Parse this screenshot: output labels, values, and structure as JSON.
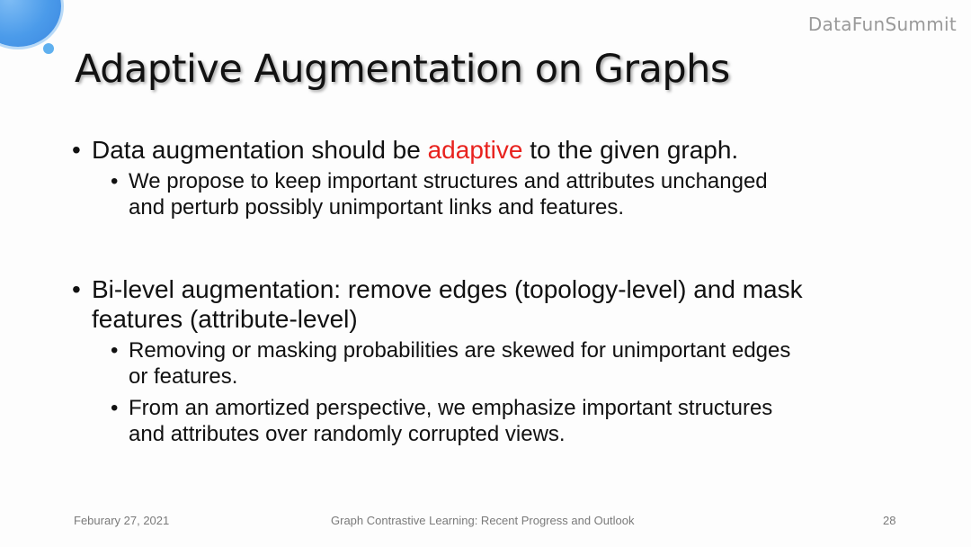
{
  "brand": "DataFunSummit",
  "title": "Adaptive Augmentation on Graphs",
  "bullets": [
    {
      "text_before": "Data augmentation should be ",
      "highlight": "adaptive",
      "text_after": " to the given graph.",
      "sub": [
        {
          "line1": "We propose to keep important structures and attributes unchanged",
          "line2": "and perturb possibly unimportant links and features."
        }
      ]
    },
    {
      "line1": "Bi-level augmentation: remove edges (topology-level) and mask",
      "line2": "features (attribute-level)",
      "sub": [
        {
          "line1": "Removing or masking probabilities are skewed for unimportant edges",
          "line2": "or features."
        },
        {
          "line1": "From an amortized perspective, we emphasize important structures",
          "line2": "and attributes over randomly corrupted views."
        }
      ]
    }
  ],
  "footer": {
    "date": "Feburary 27, 2021",
    "center": "Graph Contrastive Learning: Recent Progress and Outlook",
    "page": "28"
  },
  "colors": {
    "highlight": "#e8221e",
    "accent_blue": "#4b9bea"
  }
}
